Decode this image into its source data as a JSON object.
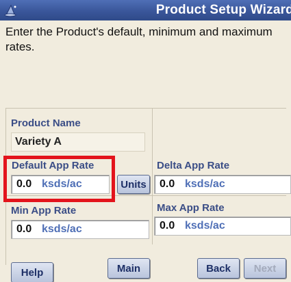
{
  "window": {
    "title": "Product Setup Wizard",
    "icon": "wizard-hat-icon",
    "title_color": "#3a569a"
  },
  "instructions": "Enter the Product's default, minimum and maximum rates.",
  "product_name": {
    "label": "Product Name",
    "value": "Variety A"
  },
  "default_app_rate": {
    "label": "Default App Rate",
    "value": "0.0",
    "unit": "ksds/ac",
    "highlighted": true,
    "highlight_color": "#e3141c"
  },
  "units_button": {
    "label": "Units"
  },
  "delta_app_rate": {
    "label": "Delta App Rate",
    "value": "0.0",
    "unit": "ksds/ac"
  },
  "min_app_rate": {
    "label": "Min App Rate",
    "value": "0.0",
    "unit": "ksds/ac"
  },
  "max_app_rate": {
    "label": "Max App Rate",
    "value": "0.0",
    "unit": "ksds/ac"
  },
  "buttons": {
    "help": "Help",
    "main": "Main",
    "back": "Back",
    "next": "Next"
  }
}
